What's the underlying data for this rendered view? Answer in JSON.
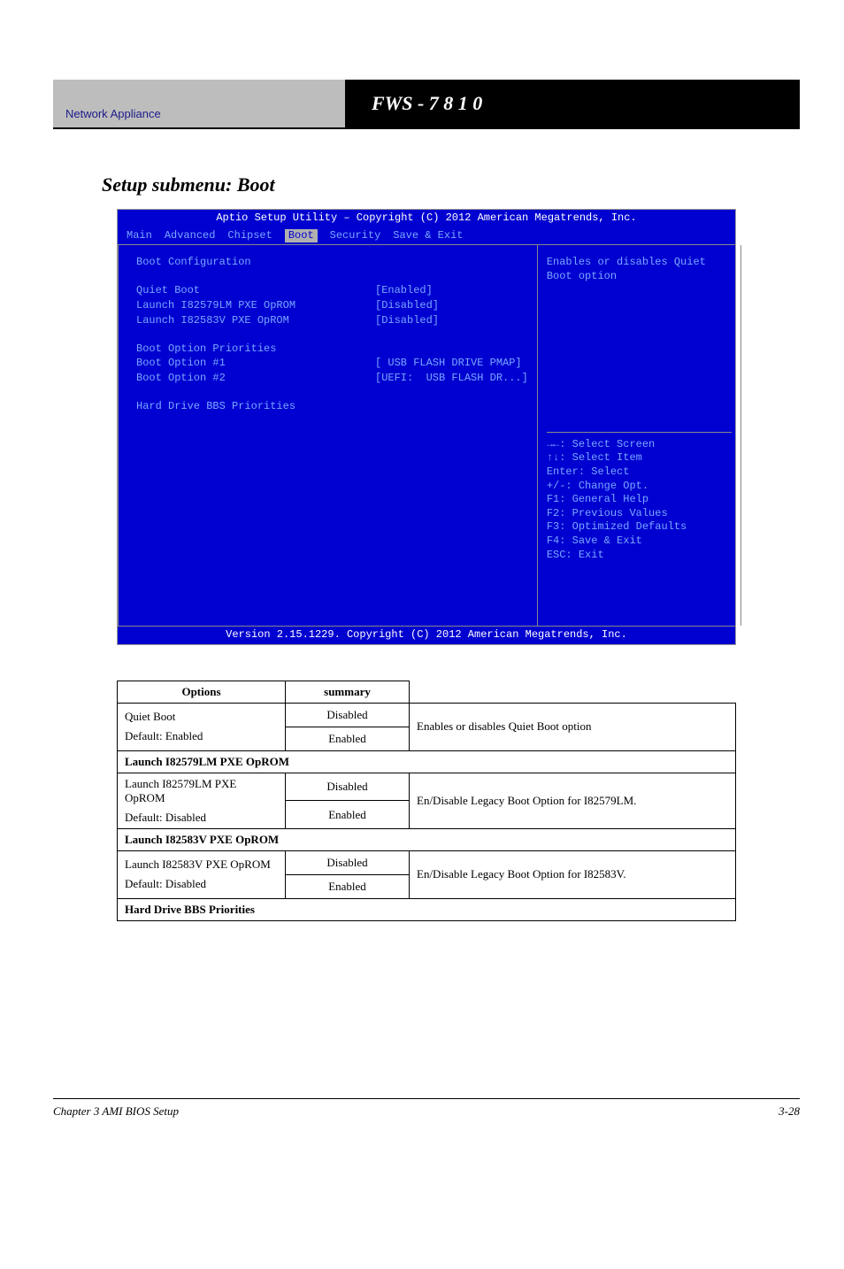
{
  "header": {
    "left_text": "Network Appliance",
    "right_text": "FWS - 7 8 1 0",
    "model_code": "F W S - 7 8 1 0"
  },
  "section_title": "Setup submenu: Boot",
  "bios": {
    "title": "Aptio Setup Utility – Copyright (C) 2012 American Megatrends, Inc.",
    "tabs": [
      "Main",
      "Advanced",
      "Chipset",
      "Boot",
      "Security",
      "Save & Exit"
    ],
    "active_tab": "Boot",
    "rows": [
      {
        "type": "heading",
        "text": "Boot Configuration"
      },
      {
        "type": "blank"
      },
      {
        "type": "kv",
        "label": "Quiet Boot",
        "value": "[Enabled]"
      },
      {
        "type": "kv",
        "label": "Launch I82579LM PXE OpROM",
        "value": "[Disabled]"
      },
      {
        "type": "kv",
        "label": "Launch I82583V PXE OpROM",
        "value": "[Disabled]"
      },
      {
        "type": "blank"
      },
      {
        "type": "heading",
        "text": "Boot Option Priorities"
      },
      {
        "type": "kv",
        "label": "Boot Option #1",
        "value": "[ USB FLASH DRIVE PMAP]"
      },
      {
        "type": "kv",
        "label": "Boot Option #2",
        "value": "[UEFI:  USB FLASH DR...]"
      },
      {
        "type": "blank"
      },
      {
        "type": "heading",
        "text": "Hard Drive BBS Priorities"
      }
    ],
    "help": "Enables or disables Quiet Boot option",
    "keys": [
      "→←: Select Screen",
      "↑↓: Select Item",
      "Enter: Select",
      "+/-: Change Opt.",
      "F1: General Help",
      "F2: Previous Values",
      "F3: Optimized Defaults",
      "F4: Save & Exit",
      "ESC: Exit"
    ],
    "footer": "Version 2.15.1229. Copyright (C) 2012 American Megatrends, Inc."
  },
  "table": {
    "head": [
      "Options",
      "summary"
    ],
    "groups": [
      {
        "name": "Quiet Boot",
        "opts": [
          "Disabled",
          "Enabled"
        ],
        "default_label": "Default: Enabled",
        "summary": "Enables or disables Quiet Boot option"
      },
      {
        "group_label": "Launch I82579LM PXE OpROM"
      },
      {
        "name": "Launch I82579LM PXE OpROM",
        "opts": [
          "Disabled",
          "Enabled"
        ],
        "default_label": "Default: Disabled",
        "summary": "En/Disable Legacy Boot Option for I82579LM."
      },
      {
        "group_label": "Launch I82583V PXE OpROM"
      },
      {
        "name": "Launch I82583V PXE OpROM",
        "opts": [
          "Disabled",
          "Enabled"
        ],
        "default_label": "Default: Disabled",
        "summary": "En/Disable Legacy Boot Option for I82583V."
      },
      {
        "group_label": "Hard Drive BBS Priorities"
      }
    ]
  },
  "footer": {
    "left": "Chapter 3 AMI BIOS Setup",
    "right": "3-28"
  }
}
